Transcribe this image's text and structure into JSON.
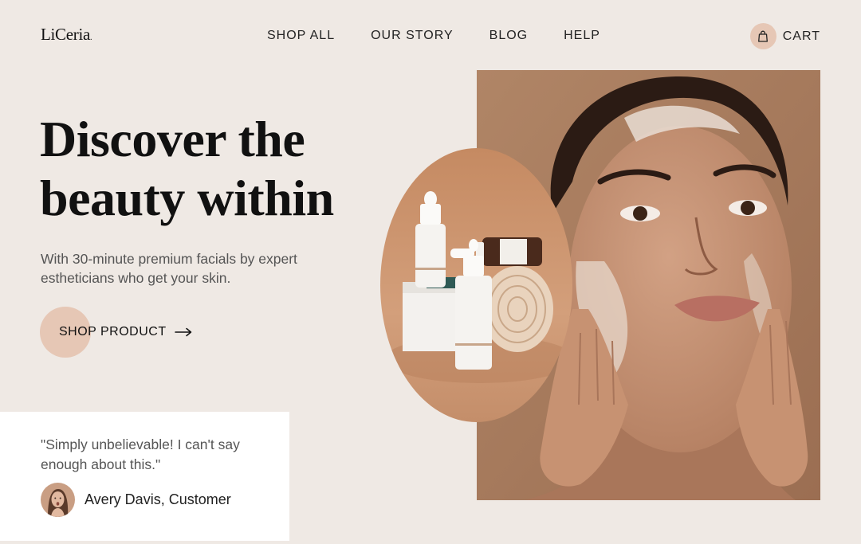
{
  "brand": {
    "name": "LiCeria",
    "suffix": "."
  },
  "nav": {
    "items": [
      "SHOP ALL",
      "OUR STORY",
      "BLOG",
      "HELP"
    ]
  },
  "cart": {
    "label": "CART",
    "icon": "shopping-bag-icon"
  },
  "hero": {
    "title_line1": "Discover the",
    "title_line2": "beauty within",
    "subtitle": "With 30-minute premium facials by expert estheticians who get your skin.",
    "cta_label": "SHOP PRODUCT",
    "cta_icon": "arrow-right-icon"
  },
  "testimonial": {
    "quote": "\"Simply unbelievable! I can't say enough about this.\"",
    "author": "Avery Davis, Customer"
  },
  "colors": {
    "background": "#efe9e4",
    "accent_peach": "#e6c7b5",
    "card": "#ffffff",
    "photo_backdrop": "#a97a5a"
  }
}
